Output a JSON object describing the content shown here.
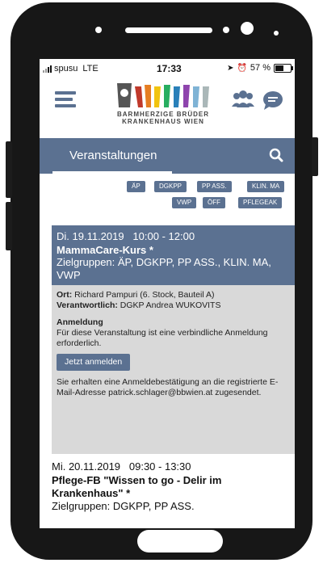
{
  "status_bar": {
    "carrier": "spusu",
    "network": "LTE",
    "time": "17:33",
    "battery_text": "57 %",
    "battery_level": 0.57
  },
  "header": {
    "logo_line1": "BARMHERZIGE BRÜDER",
    "logo_line2": "KRANKENHAUS WIEN",
    "icons": [
      "menu-icon",
      "people-icon",
      "chat-icon"
    ]
  },
  "nav": {
    "title": "Veranstaltungen",
    "search_icon": "search-icon"
  },
  "filters": [
    "ÄP",
    "DGKPP",
    "PP ASS.",
    "KLIN. MA",
    "VWP",
    "ÖFF",
    "PFLEGEAK"
  ],
  "events": [
    {
      "date_time": "Di. 19.11.2019   10:00 - 12:00",
      "title": "MammaCare-Kurs *",
      "groups": "Zielgruppen: ÄP, DGKPP, PP ASS., KLIN. MA, VWP",
      "place_label": "Ort:",
      "place_value": " Richard Pampuri (6. Stock, Bauteil A)",
      "responsible_label": "Verantwortlich:",
      "responsible_value": " DGKP Andrea WUKOVITS",
      "registration_title": "Anmeldung",
      "registration_text": "Für diese Veranstaltung ist eine verbindliche Anmeldung erforderlich.",
      "register_button": "Jetzt anmelden",
      "confirmation_text": "Sie erhalten eine Anmeldebestätigung an die registrierte E-Mail-Adresse patrick.schlager@bbwien.at zugesendet."
    },
    {
      "date_time": "Mi. 20.11.2019   09:30 - 13:30",
      "title": "Pflege-FB \"Wissen to go - Delir im Krankenhaus\" *",
      "groups": "Zielgruppen: DGKPP, PP ASS."
    }
  ],
  "colors": {
    "accent": "#5b7191",
    "panel": "#d9d9d9",
    "phone": "#171717"
  }
}
